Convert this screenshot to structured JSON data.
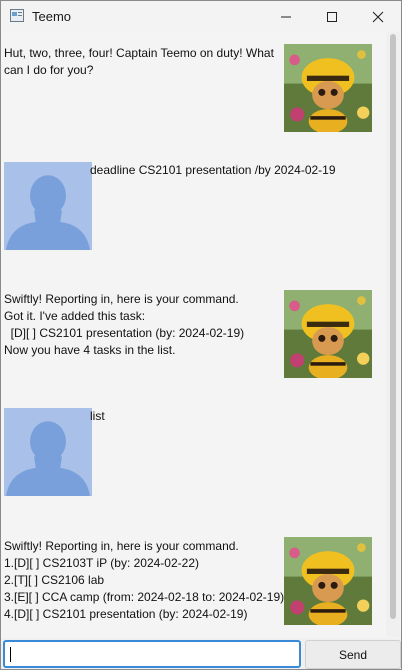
{
  "window": {
    "title": "Teemo"
  },
  "conversation": [
    {
      "speaker": "bot",
      "text": "Hut, two, three, four! Captain Teemo on duty! What\ncan I do for you?"
    },
    {
      "speaker": "user",
      "text": "deadline CS2101 presentation /by 2024-02-19"
    },
    {
      "speaker": "bot",
      "text": "Swiftly! Reporting in, here is your command.\nGot it. I've added this task:\n  [D][ ] CS2101 presentation (by: 2024-02-19)\nNow you have 4 tasks in the list."
    },
    {
      "speaker": "user",
      "text": "list"
    },
    {
      "speaker": "bot",
      "text": "Swiftly! Reporting in, here is your command.\n1.[D][ ] CS2103T iP (by: 2024-02-22)\n2.[T][ ] CS2106 lab\n3.[E][ ] CCA camp (from: 2024-02-18 to: 2024-02-19)\n4.[D][ ] CS2101 presentation (by: 2024-02-19)"
    }
  ],
  "input": {
    "value": "",
    "placeholder": ""
  },
  "send_button": {
    "label": "Send"
  },
  "icons": {
    "bot_avatar": "teemo-avatar-icon",
    "user_avatar": "user-silhouette-icon"
  }
}
